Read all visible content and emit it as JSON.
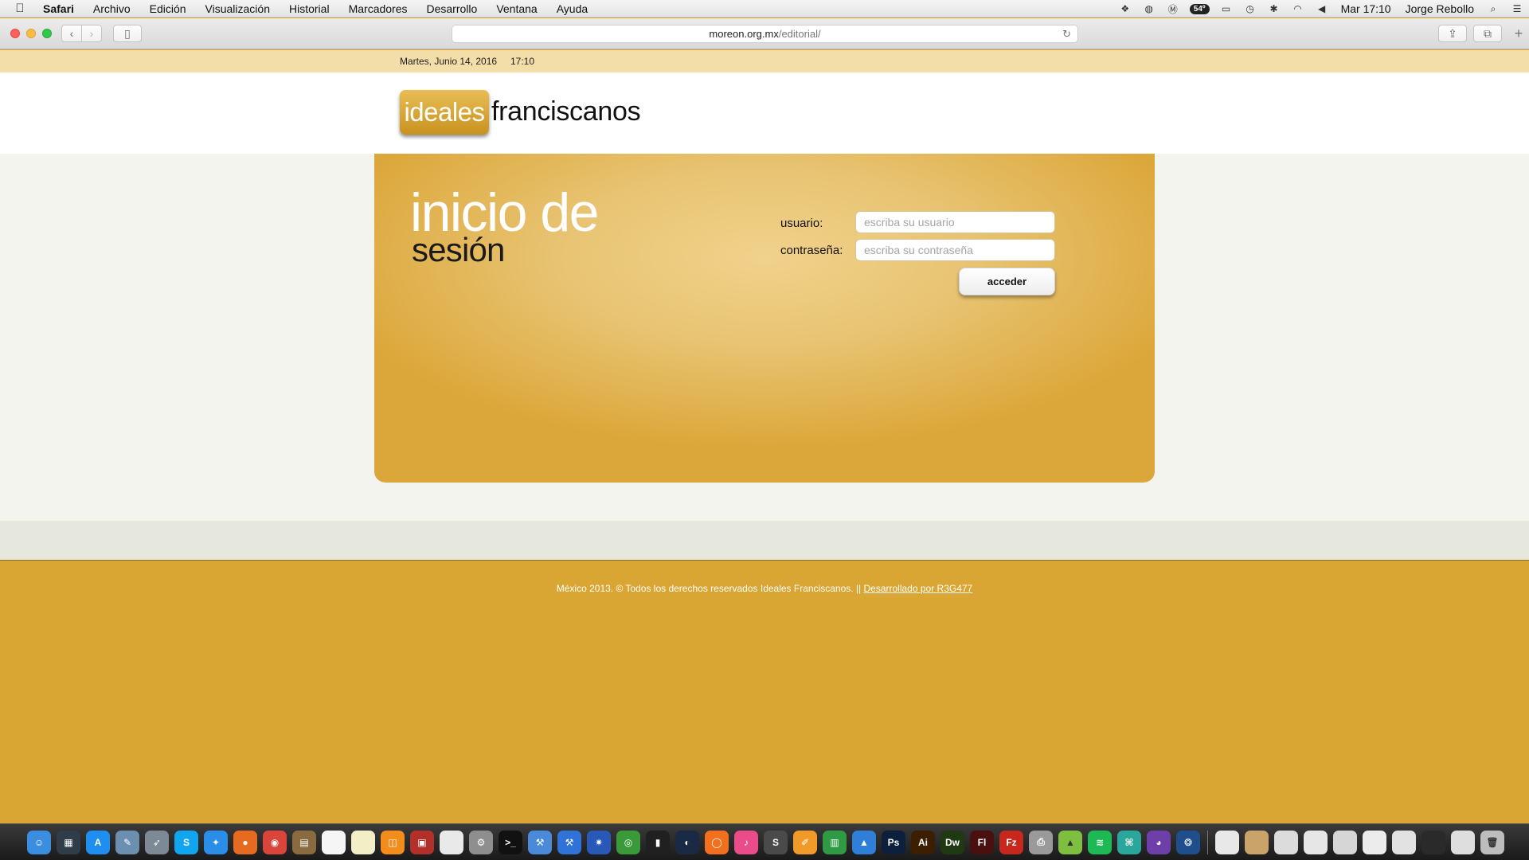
{
  "menubar": {
    "app_name": "Safari",
    "items": [
      "Archivo",
      "Edición",
      "Visualización",
      "Historial",
      "Marcadores",
      "Desarrollo",
      "Ventana",
      "Ayuda"
    ],
    "temperature": "54º",
    "clock": "Mar 17:10",
    "user": "Jorge Rebollo",
    "status_icons": [
      "dropbox-icon",
      "sync-icon",
      "m-icon",
      "airplay-icon",
      "time-machine-icon",
      "bluetooth-icon",
      "wifi-icon",
      "volume-icon",
      "spotlight-icon",
      "notification-center-icon"
    ]
  },
  "browser": {
    "url_host": "moreon.org.mx",
    "url_path": "/editorial/"
  },
  "page": {
    "date": "Martes, Junio 14, 2016",
    "time": "17:10",
    "logo_box": "ideales",
    "logo_text": "franciscanos",
    "title_line1": "inicio de",
    "title_line2": "sesión",
    "user_label": "usuario:",
    "user_placeholder": "escriba su usuario",
    "password_label": "contraseña:",
    "password_placeholder": "escriba su contraseña",
    "submit_label": "acceder",
    "footer_text": "México 2013. © Todos los derechos reservados Ideales Franciscanos. || ",
    "footer_link": "Desarrollado por R3G477"
  },
  "dock": {
    "apps": [
      {
        "name": "finder",
        "color": "#3b8de0",
        "glyph": "☺"
      },
      {
        "name": "mission-control",
        "color": "#2f3d4a",
        "glyph": "▦"
      },
      {
        "name": "app-store",
        "color": "#1e8ff0",
        "glyph": "A"
      },
      {
        "name": "preview",
        "color": "#6c8fb0",
        "glyph": "✎"
      },
      {
        "name": "launchpad",
        "color": "#7d8a96",
        "glyph": "➶"
      },
      {
        "name": "skype",
        "color": "#12a5ef",
        "glyph": "S"
      },
      {
        "name": "safari",
        "color": "#2a8de8",
        "glyph": "✦"
      },
      {
        "name": "firefox",
        "color": "#e66a1f",
        "glyph": "●"
      },
      {
        "name": "chrome",
        "color": "#d9453a",
        "glyph": "◉"
      },
      {
        "name": "notefile",
        "color": "#8a6b3f",
        "glyph": "▤"
      },
      {
        "name": "calendar",
        "color": "#f5f5f5",
        "glyph": ""
      },
      {
        "name": "notes",
        "color": "#f3eec6",
        "glyph": ""
      },
      {
        "name": "ibooks",
        "color": "#f28d1c",
        "glyph": "◫"
      },
      {
        "name": "photo-booth",
        "color": "#b3302a",
        "glyph": "▣"
      },
      {
        "name": "textedit",
        "color": "#e9e9e9",
        "glyph": ""
      },
      {
        "name": "system-preferences",
        "color": "#8e8e8e",
        "glyph": "⚙"
      },
      {
        "name": "terminal",
        "color": "#111111",
        "glyph": ">_"
      },
      {
        "name": "xcode",
        "color": "#4a8ad8",
        "glyph": "⚒"
      },
      {
        "name": "xcode-instruments",
        "color": "#2f73d8",
        "glyph": "⚒"
      },
      {
        "name": "network-utility",
        "color": "#2858b8",
        "glyph": "✷"
      },
      {
        "name": "maps",
        "color": "#3a9a3a",
        "glyph": "◎"
      },
      {
        "name": "console",
        "color": "#202020",
        "glyph": "▮"
      },
      {
        "name": "steam",
        "color": "#1a2a44",
        "glyph": "◐"
      },
      {
        "name": "origin",
        "color": "#f2701d",
        "glyph": "◯"
      },
      {
        "name": "itunes",
        "color": "#ea4c89",
        "glyph": "♪"
      },
      {
        "name": "sublime-text",
        "color": "#4a4a4a",
        "glyph": "S"
      },
      {
        "name": "pages",
        "color": "#f09a2a",
        "glyph": "✐"
      },
      {
        "name": "numbers",
        "color": "#2f9a44",
        "glyph": "▥"
      },
      {
        "name": "keynote",
        "color": "#2f7fd8",
        "glyph": "▲"
      },
      {
        "name": "photoshop",
        "color": "#0c1f3c",
        "glyph": "Ps"
      },
      {
        "name": "illustrator",
        "color": "#3b1f00",
        "glyph": "Ai"
      },
      {
        "name": "dreamweaver",
        "color": "#1f3a12",
        "glyph": "Dw"
      },
      {
        "name": "flash",
        "color": "#4a0f0f",
        "glyph": "Fl"
      },
      {
        "name": "filezilla",
        "color": "#c8271d",
        "glyph": "Fz"
      },
      {
        "name": "printer",
        "color": "#9a9a9a",
        "glyph": "⎙"
      },
      {
        "name": "android-studio",
        "color": "#7fbf3f",
        "glyph": "▲"
      },
      {
        "name": "spotify",
        "color": "#1db954",
        "glyph": "≋"
      },
      {
        "name": "vpn",
        "color": "#2aa79a",
        "glyph": "⌘"
      },
      {
        "name": "github",
        "color": "#6e3fa8",
        "glyph": "◕"
      },
      {
        "name": "sourcetree",
        "color": "#1e4f8c",
        "glyph": "❂"
      }
    ],
    "stack_items": [
      {
        "name": "document",
        "color": "#e8e8e8",
        "glyph": ""
      },
      {
        "name": "archive",
        "color": "#c9a36a",
        "glyph": ""
      },
      {
        "name": "screenshot-1",
        "color": "#dcdcdc",
        "glyph": ""
      },
      {
        "name": "screenshot-2",
        "color": "#e6e6e6",
        "glyph": ""
      },
      {
        "name": "screenshot-3",
        "color": "#d6d6d6",
        "glyph": ""
      },
      {
        "name": "screenshot-4",
        "color": "#ececec",
        "glyph": ""
      },
      {
        "name": "screenshot-5",
        "color": "#e2e2e2",
        "glyph": ""
      },
      {
        "name": "screenshot-6",
        "color": "#2a2a2a",
        "glyph": ""
      },
      {
        "name": "screenshot-7",
        "color": "#dedede",
        "glyph": ""
      },
      {
        "name": "trash",
        "color": "#bdbdbd",
        "glyph": "🗑"
      }
    ]
  }
}
